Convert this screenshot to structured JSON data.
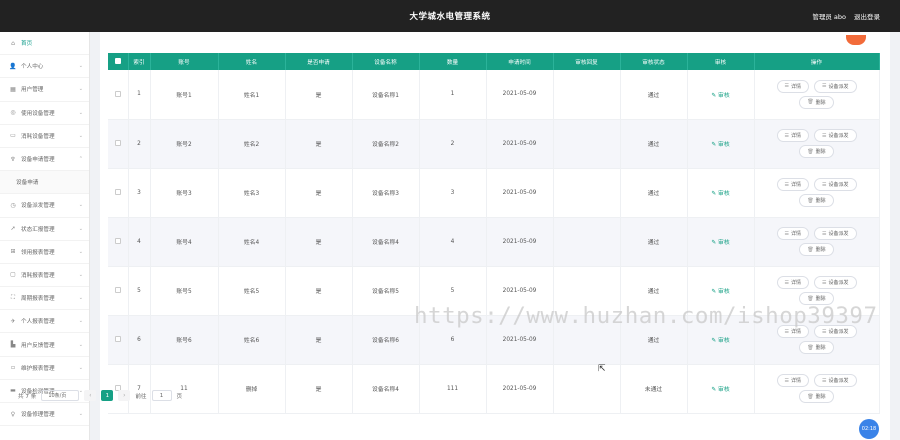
{
  "header": {
    "title": "大学城水电管理系统",
    "user_label": "管理员 abo",
    "logout_label": "退出登录"
  },
  "sidebar": {
    "items": [
      {
        "label": "首页",
        "icon": "home-icon",
        "glyph": "⌂",
        "chevron": false,
        "sub": false
      },
      {
        "label": "个人中心",
        "icon": "user-icon",
        "glyph": "👤",
        "chevron": true,
        "sub": false
      },
      {
        "label": "用户管理",
        "icon": "users-icon",
        "glyph": "▦",
        "chevron": true,
        "sub": false
      },
      {
        "label": "使用设备管理",
        "icon": "device-icon",
        "glyph": "◎",
        "chevron": true,
        "sub": false
      },
      {
        "label": "消耗设备管理",
        "icon": "box-icon",
        "glyph": "▭",
        "chevron": true,
        "sub": false
      },
      {
        "label": "设备申请管理",
        "icon": "apply-icon",
        "glyph": "♆",
        "chevron": true,
        "sub": false
      },
      {
        "label": "设备申请",
        "icon": "",
        "glyph": "",
        "chevron": false,
        "sub": true
      },
      {
        "label": "设备派发管理",
        "icon": "dispatch-icon",
        "glyph": "◷",
        "chevron": true,
        "sub": false
      },
      {
        "label": "状态汇报管理",
        "icon": "report-icon",
        "glyph": "➚",
        "chevron": true,
        "sub": false
      },
      {
        "label": "领用报表管理",
        "icon": "grid-icon",
        "glyph": "⊞",
        "chevron": true,
        "sub": false
      },
      {
        "label": "消耗报表管理",
        "icon": "chat-icon",
        "glyph": "▢",
        "chevron": true,
        "sub": false
      },
      {
        "label": "周期报表管理",
        "icon": "frame-icon",
        "glyph": "⛶",
        "chevron": true,
        "sub": false
      },
      {
        "label": "个人报表管理",
        "icon": "send-icon",
        "glyph": "✈",
        "chevron": true,
        "sub": false
      },
      {
        "label": "用户反馈管理",
        "icon": "building-icon",
        "glyph": "▙",
        "chevron": true,
        "sub": false
      },
      {
        "label": "维护报表管理",
        "icon": "tool-icon",
        "glyph": "▫",
        "chevron": true,
        "sub": false
      },
      {
        "label": "设备检测管理",
        "icon": "monitor-icon",
        "glyph": "▬",
        "chevron": true,
        "sub": false
      },
      {
        "label": "设备修理管理",
        "icon": "pin-icon",
        "glyph": "♀",
        "chevron": true,
        "sub": false
      }
    ]
  },
  "table": {
    "columns": [
      "",
      "索引",
      "账号",
      "姓名",
      "是否申请",
      "设备名称",
      "数量",
      "申请时间",
      "审核回复",
      "审核状态",
      "审核",
      "操作"
    ],
    "rows": [
      {
        "index": "1",
        "account": "账号1",
        "name": "姓名1",
        "applied": "是",
        "device": "设备名称1",
        "qty": "1",
        "time": "2021-05-09",
        "reply": "",
        "status": "通过"
      },
      {
        "index": "2",
        "account": "账号2",
        "name": "姓名2",
        "applied": "是",
        "device": "设备名称2",
        "qty": "2",
        "time": "2021-05-09",
        "reply": "",
        "status": "通过"
      },
      {
        "index": "3",
        "account": "账号3",
        "name": "姓名3",
        "applied": "是",
        "device": "设备名称3",
        "qty": "3",
        "time": "2021-05-09",
        "reply": "",
        "status": "通过"
      },
      {
        "index": "4",
        "account": "账号4",
        "name": "姓名4",
        "applied": "是",
        "device": "设备名称4",
        "qty": "4",
        "time": "2021-05-09",
        "reply": "",
        "status": "通过"
      },
      {
        "index": "5",
        "account": "账号5",
        "name": "姓名5",
        "applied": "是",
        "device": "设备名称5",
        "qty": "5",
        "time": "2021-05-09",
        "reply": "",
        "status": "通过"
      },
      {
        "index": "6",
        "account": "账号6",
        "name": "姓名6",
        "applied": "是",
        "device": "设备名称6",
        "qty": "6",
        "time": "2021-05-09",
        "reply": "",
        "status": "通过"
      },
      {
        "index": "7",
        "account": "11",
        "name": "删掉",
        "applied": "是",
        "device": "设备名称4",
        "qty": "111",
        "time": "2021-05-09",
        "reply": "",
        "status": "未通过"
      }
    ],
    "audit_label": "审核",
    "op_detail": "详情",
    "op_dispatch": "设备派发",
    "op_delete": "删除"
  },
  "pagination": {
    "total_label": "共 7 条",
    "page_size": "10条/页",
    "current_page": "1",
    "goto_prefix": "前往",
    "goto_value": "1",
    "goto_suffix": "页"
  },
  "watermark": "https://www.huzhan.com/ishop39397",
  "clock": "02:18",
  "colors": {
    "accent": "#16a085",
    "topbar": "#222222",
    "add_button": "#f26b3a",
    "clock": "#3a83e8"
  }
}
